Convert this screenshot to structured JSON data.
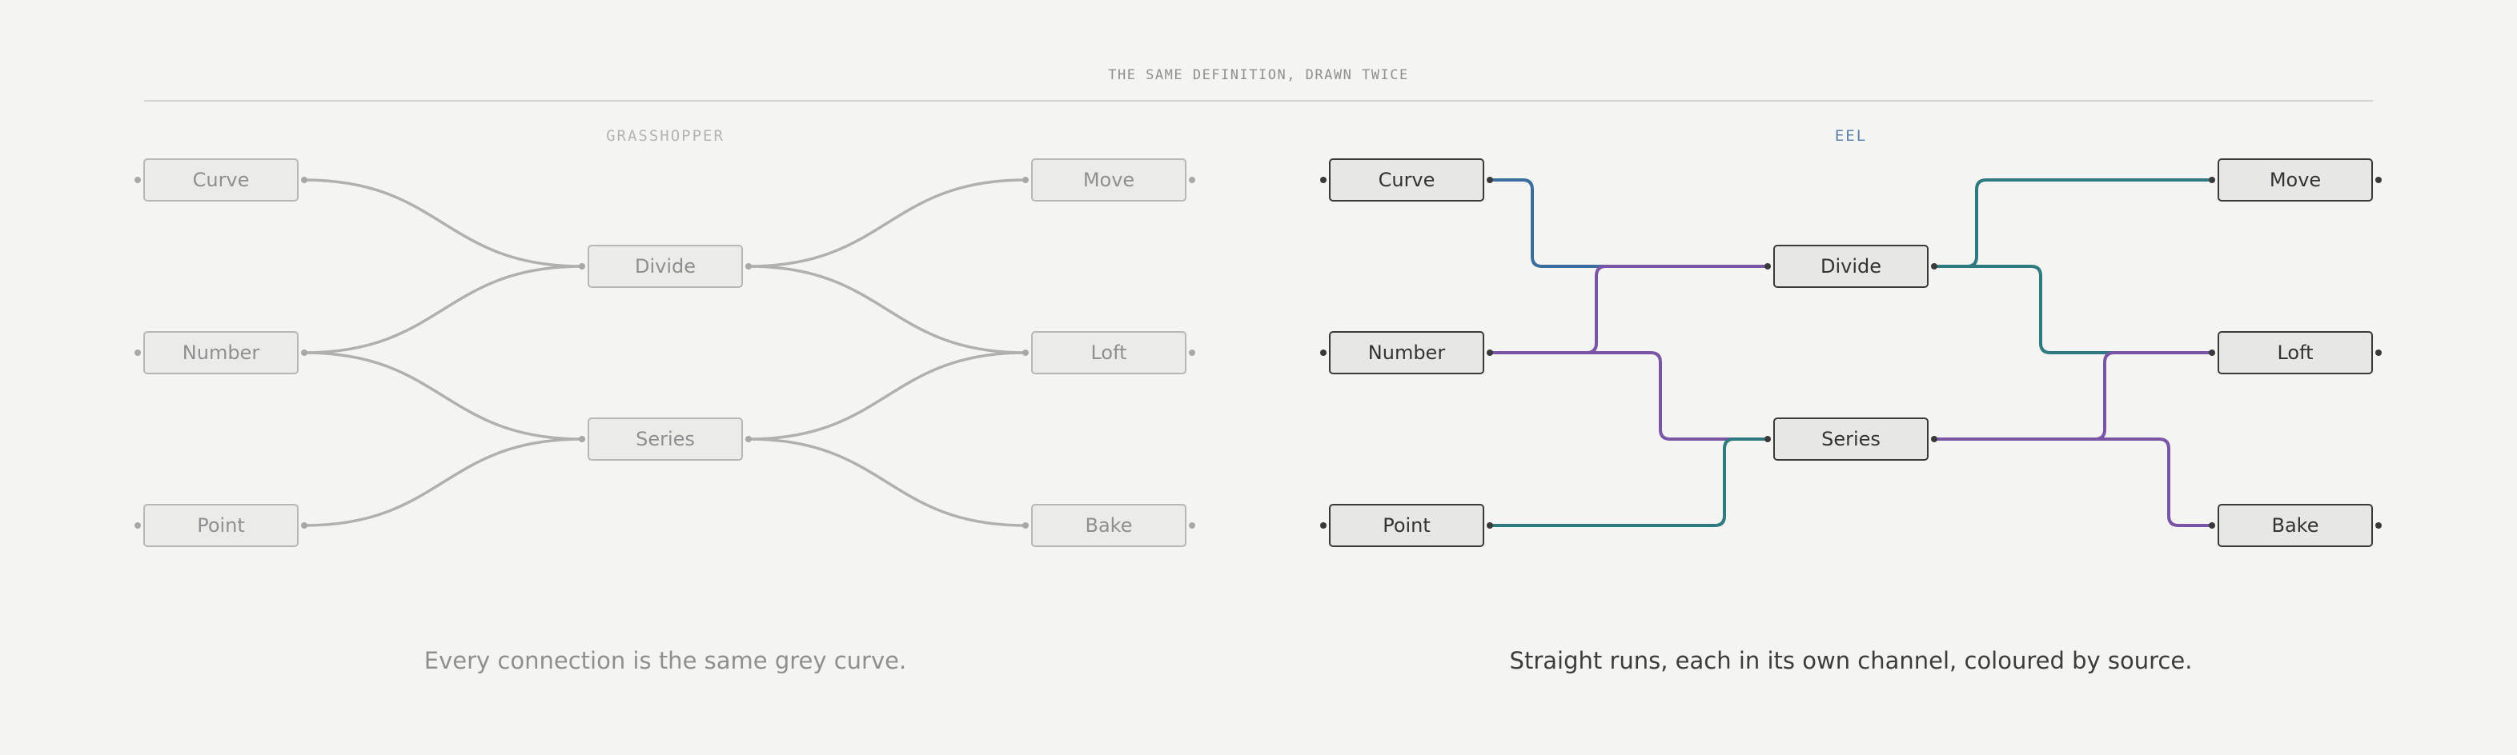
{
  "header": {
    "title": "THE SAME DEFINITION, DRAWN TWICE"
  },
  "panels": {
    "grasshopper": {
      "label": "GRASSHOPPER",
      "caption": "Every connection is the same grey curve.",
      "nodes": [
        "Curve",
        "Number",
        "Point",
        "Divide",
        "Series",
        "Move",
        "Loft",
        "Bake"
      ]
    },
    "eel": {
      "label": "EEL",
      "caption": "Straight runs, each in its own channel, coloured by source.",
      "nodes": [
        "Curve",
        "Number",
        "Point",
        "Divide",
        "Series",
        "Move",
        "Loft",
        "Bake"
      ]
    }
  },
  "graph": {
    "edges": [
      [
        "Curve",
        "Divide"
      ],
      [
        "Number",
        "Divide"
      ],
      [
        "Number",
        "Series"
      ],
      [
        "Point",
        "Series"
      ],
      [
        "Divide",
        "Move"
      ],
      [
        "Divide",
        "Loft"
      ],
      [
        "Series",
        "Loft"
      ],
      [
        "Series",
        "Bake"
      ]
    ]
  },
  "colors": {
    "background": "#f4f4f2",
    "grey_wire": "#b0b0ae",
    "eel_blue": "#3b6e9e",
    "eel_purple": "#7a55a6",
    "eel_teal": "#2f7a7e"
  }
}
